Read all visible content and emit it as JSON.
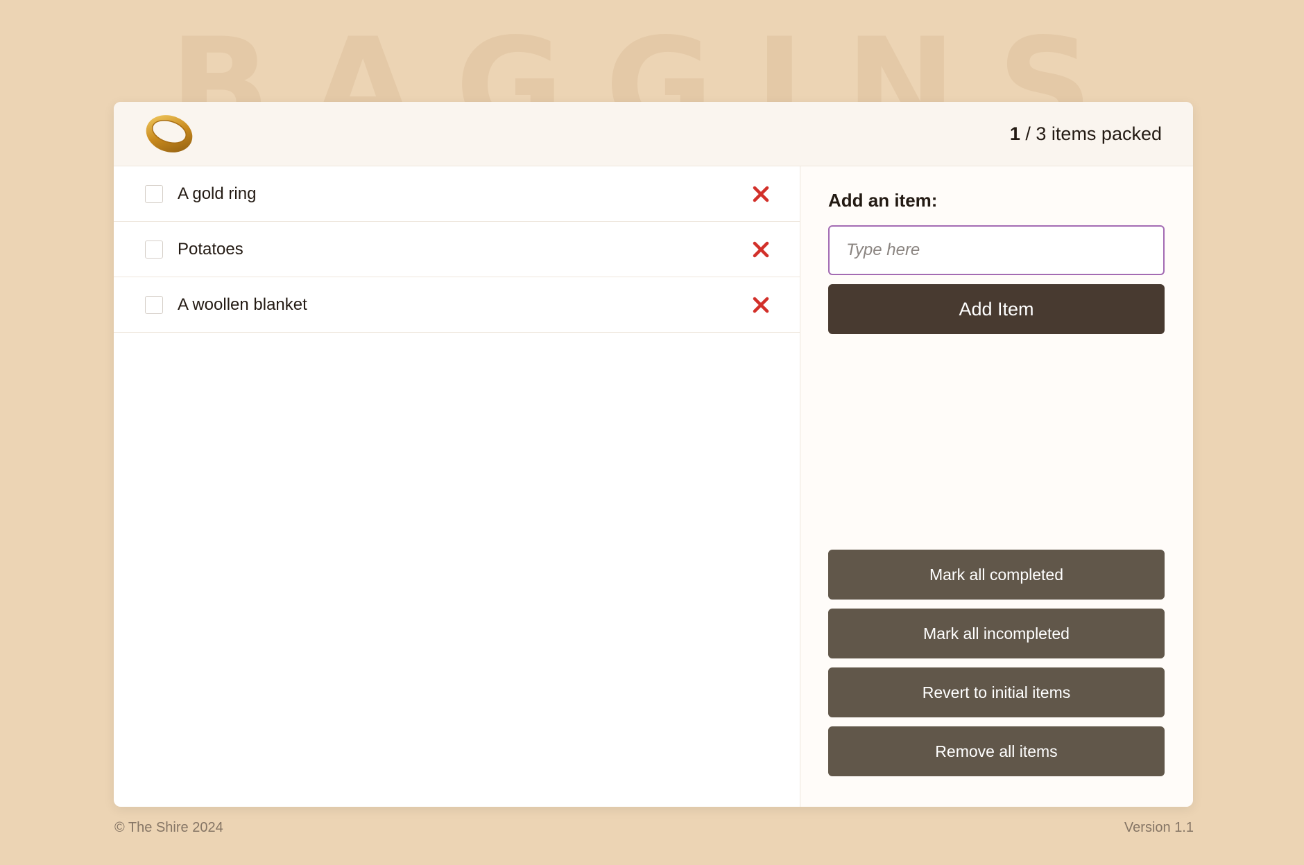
{
  "background_title": "BAGGINS",
  "header": {
    "logo_icon": "gold-ring-icon",
    "packed_count": "1",
    "counter_suffix": "/ 3 items packed"
  },
  "items": [
    {
      "label": "A gold ring",
      "checked": false
    },
    {
      "label": "Potatoes",
      "checked": false
    },
    {
      "label": "A woollen blanket",
      "checked": false
    }
  ],
  "add_form": {
    "label": "Add an item:",
    "placeholder": "Type here",
    "value": "",
    "button_label": "Add Item"
  },
  "actions": {
    "mark_all_completed": "Mark all completed",
    "mark_all_incompleted": "Mark all incompleted",
    "revert": "Revert to initial items",
    "remove_all": "Remove all items"
  },
  "footer": {
    "copyright": "© The Shire 2024",
    "version": "Version 1.1"
  },
  "colors": {
    "page_bg": "#ecd4b4",
    "primary_button": "#483a30",
    "secondary_button": "#61574a",
    "input_focus": "#a36bb3",
    "delete_red": "#d2302a"
  }
}
